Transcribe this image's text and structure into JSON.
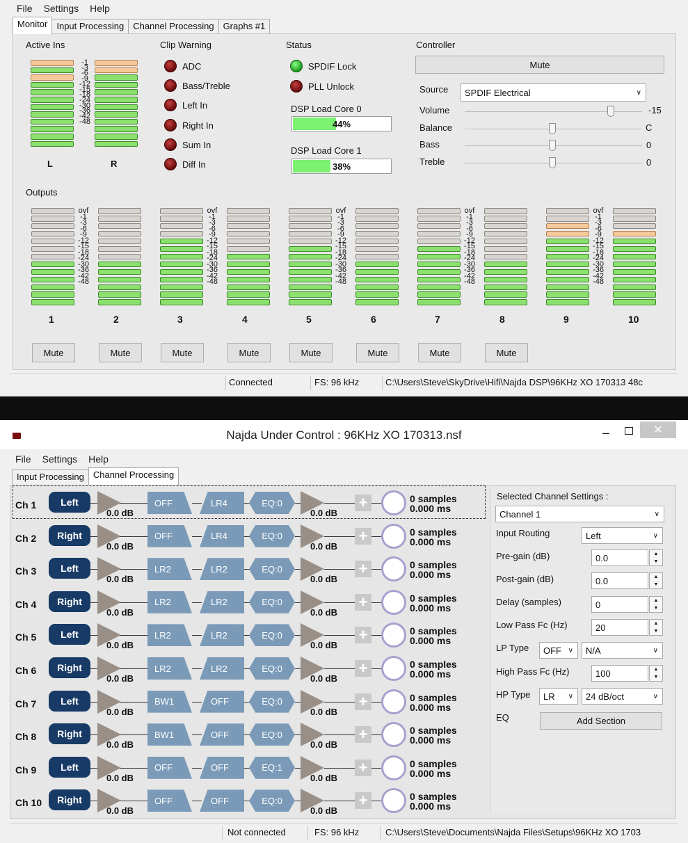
{
  "top": {
    "menu": [
      "File",
      "Settings",
      "Help"
    ],
    "tabs": [
      "Monitor",
      "Input Processing",
      "Channel Processing",
      "Graphs #1"
    ],
    "active_ins": {
      "title": "Active Ins",
      "ticks": [
        "-1",
        "-3",
        "-6",
        "-9",
        "-12",
        "-15",
        "-18",
        "-24",
        "-30",
        "-36",
        "-42",
        "-48"
      ],
      "left_label": "L",
      "right_label": "R"
    },
    "clip_warning": {
      "title": "Clip Warning",
      "items": [
        "ADC",
        "Bass/Treble",
        "Left In",
        "Right In",
        "Sum In",
        "Diff In"
      ]
    },
    "status": {
      "title": "Status",
      "spdif_lock": "SPDIF Lock",
      "pll_unlock": "PLL Unlock",
      "dsp0_label": "DSP Load Core 0",
      "dsp0_value": "44%",
      "dsp0_fraction": 0.44,
      "dsp1_label": "DSP Load Core 1",
      "dsp1_value": "38%",
      "dsp1_fraction": 0.38
    },
    "controller": {
      "title": "Controller",
      "mute": "Mute",
      "source_label": "Source",
      "source_value": "SPDIF Electrical",
      "volume_label": "Volume",
      "volume_value": "-15",
      "balance_label": "Balance",
      "balance_value": "C",
      "bass_label": "Bass",
      "bass_value": "0",
      "treble_label": "Treble",
      "treble_value": "0"
    },
    "outputs": {
      "title": "Outputs",
      "ticks": [
        "ovf",
        "-1",
        "-3",
        "-6",
        "-9",
        "-12",
        "-15",
        "-18",
        "-24",
        "-30",
        "-36",
        "-42",
        "-48"
      ],
      "channels": [
        "1",
        "2",
        "3",
        "4",
        "5",
        "6",
        "7",
        "8",
        "9",
        "10"
      ],
      "mute_label": "Mute"
    },
    "statusbar": {
      "connection": "Connected",
      "fs": "FS: 96 kHz",
      "path": "C:\\Users\\Steve\\SkyDrive\\Hifi\\Najda DSP\\96KHz XO 170313 48c"
    }
  },
  "bottom": {
    "title": "Najda Under Control : 96KHz XO 170313.nsf",
    "menu": [
      "File",
      "Settings",
      "Help"
    ],
    "tabs": [
      "Input Processing",
      "Channel Processing"
    ],
    "gain_label": "0.0 dB",
    "samples_label": "0 samples",
    "ms_label": "0.000 ms",
    "channels": [
      {
        "name": "Ch 1",
        "input": "Left",
        "hp": "OFF",
        "lp": "LR4",
        "eq": "EQ:0"
      },
      {
        "name": "Ch 2",
        "input": "Right",
        "hp": "OFF",
        "lp": "LR4",
        "eq": "EQ:0"
      },
      {
        "name": "Ch 3",
        "input": "Left",
        "hp": "LR2",
        "lp": "LR2",
        "eq": "EQ:0"
      },
      {
        "name": "Ch 4",
        "input": "Right",
        "hp": "LR2",
        "lp": "LR2",
        "eq": "EQ:0"
      },
      {
        "name": "Ch 5",
        "input": "Left",
        "hp": "LR2",
        "lp": "LR2",
        "eq": "EQ:0"
      },
      {
        "name": "Ch 6",
        "input": "Right",
        "hp": "LR2",
        "lp": "LR2",
        "eq": "EQ:0"
      },
      {
        "name": "Ch 7",
        "input": "Left",
        "hp": "BW1",
        "lp": "OFF",
        "eq": "EQ:0"
      },
      {
        "name": "Ch 8",
        "input": "Right",
        "hp": "BW1",
        "lp": "OFF",
        "eq": "EQ:0"
      },
      {
        "name": "Ch 9",
        "input": "Left",
        "hp": "OFF",
        "lp": "OFF",
        "eq": "EQ:1"
      },
      {
        "name": "Ch 10",
        "input": "Right",
        "hp": "OFF",
        "lp": "OFF",
        "eq": "EQ:0"
      }
    ],
    "settings": {
      "title": "Selected Channel Settings :",
      "channel": "Channel 1",
      "input_routing_label": "Input Routing",
      "input_routing_value": "Left",
      "pregain_label": "Pre-gain (dB)",
      "pregain_value": "0.0",
      "postgain_label": "Post-gain (dB)",
      "postgain_value": "0.0",
      "delay_label": "Delay (samples)",
      "delay_value": "0",
      "lpfc_label": "Low Pass Fc (Hz)",
      "lpfc_value": "20",
      "lptype_label": "LP Type",
      "lptype_value": "OFF",
      "lptype_slope": "N/A",
      "hpfc_label": "High Pass Fc (Hz)",
      "hpfc_value": "100",
      "hptype_label": "HP Type",
      "hptype_value": "LR",
      "hptype_slope": "24 dB/oct",
      "eq_label": "EQ",
      "add_section": "Add Section"
    },
    "statusbar": {
      "connection": "Not connected",
      "fs": "FS: 96 kHz",
      "path": "C:\\Users\\Steve\\Documents\\Najda Files\\Setups\\96KHz XO 1703"
    }
  }
}
